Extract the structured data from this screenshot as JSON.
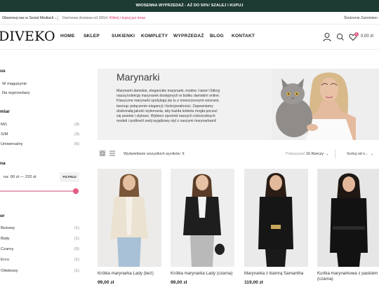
{
  "promo_bar": {
    "text": "WIOSENNA WYPRZEDAŻ - AŻ DO 50%! SZALEJ I KUPUJ"
  },
  "info_bar": {
    "social": "Obserwuj nas w Social Mediach",
    "shipping_text": "Darmowa dostawa od 300zł.",
    "shipping_link": "Kliknij i kupuj już teraz.",
    "track": "Śledzenie Zamówien"
  },
  "header": {
    "logo": "DIVEKO",
    "nav": [
      "HOME",
      "SKLEP",
      "SUKIENKI",
      "KOMPLETY",
      "WYPRZEDAŻ",
      "BLOG",
      "KONTAKT"
    ],
    "cart_count": "0",
    "cart_total": "0,00 zł",
    "icons": [
      "user-icon",
      "search-icon",
      "heart-icon",
      "cart-icon"
    ]
  },
  "sidebar": {
    "status_title": "us",
    "status_items": [
      "W magazynie",
      "Na wyprzedaży"
    ],
    "size_title": "miar",
    "sizes": [
      {
        "label": "M/L",
        "count": "(3)"
      },
      {
        "label": "S/M",
        "count": "(3)"
      },
      {
        "label": "Uniwersalny",
        "count": "(6)"
      }
    ],
    "price_title": "na",
    "price_range": "na: 90 zł — 220 zł",
    "filter_button": "FILTRUJ",
    "color_title": "or",
    "colors": [
      {
        "label": "Beżowy",
        "count": "(1)"
      },
      {
        "label": "Biały",
        "count": "(1)"
      },
      {
        "label": "Czarny",
        "count": "(5)"
      },
      {
        "label": "Ecru",
        "count": "(1)"
      },
      {
        "label": "Oliwkowy",
        "count": "(1)"
      }
    ],
    "accent_color": "#e35b82"
  },
  "banner": {
    "title": "Marynarki",
    "text": "Marynarki damskie, eleganckie marynarki, modne i tanie! Odkryj naszą kolekcję marynarek dostępnych w butiku damskim online. Klasyczne marynarki spotykają się tu z nowoczesnymi wzorami, tworząc połączenie elegancji i funkcjonalności. Zapewniamy doskonałą jakość wykonania, aby każda kobieta mogła poczuć się pewnie i stylowo. Wybierz spośród naszych różnorodnych modeli i podkreśl swój wyjątkowy styl z naszymi marynarkami!"
  },
  "toolbar": {
    "results": "Wyświetlanie wszystkich wyników: 9",
    "per_page_label": "Pokazywać:",
    "per_page_value": "16 Rzeczy",
    "sort_label": "Sortuj od n..."
  },
  "products": [
    {
      "name": "Krótka marynarka Lady (beż)",
      "price": "99,00 zł"
    },
    {
      "name": "Krótka marynarka Lady (czarna)",
      "price": "99,00 zł"
    },
    {
      "name": "Marynarka z klamrą Samantha",
      "price": "119,00 zł"
    },
    {
      "name": "Kurtka marynarkowa z paskiem (czarna)",
      "price": ""
    }
  ],
  "colors": {
    "promo_bg": "#1d3a33",
    "accent": "#e35b82",
    "banner_bg": "#f1f1f1"
  }
}
